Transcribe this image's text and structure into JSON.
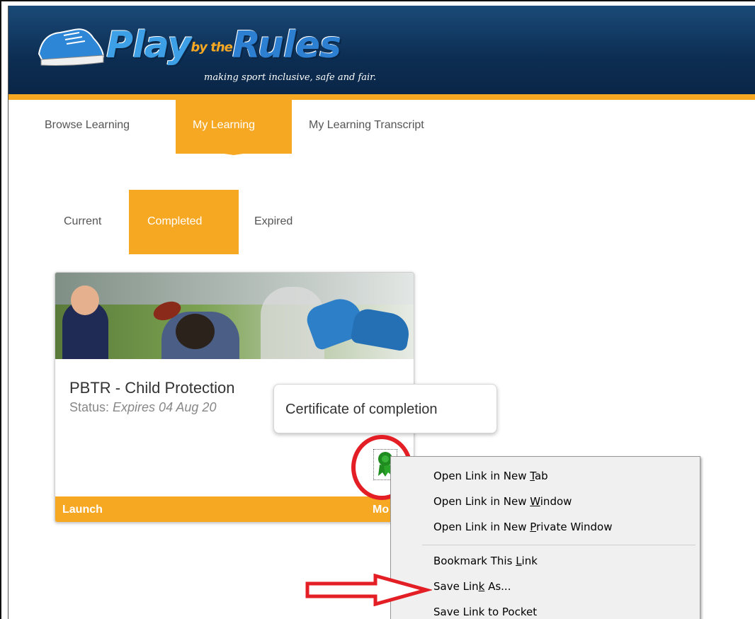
{
  "brand": {
    "wordmark_play": "Play",
    "wordmark_by": "by the",
    "wordmark_rules": "Rules",
    "tagline": "making sport inclusive, safe and fair."
  },
  "nav": {
    "items": [
      {
        "label": "Browse Learning"
      },
      {
        "label": "My Learning",
        "active": true
      },
      {
        "label": "My Learning Transcript"
      }
    ]
  },
  "subtabs": [
    {
      "label": "Current"
    },
    {
      "label": "Completed",
      "active": true
    },
    {
      "label": "Expired"
    }
  ],
  "course_card": {
    "title": "PBTR - Child Protection",
    "status_label": "Status: ",
    "status_value": "Expires 04 Aug 20",
    "launch_label": "Launch",
    "more_label": "Mo"
  },
  "tooltip": {
    "text": "Certificate of completion"
  },
  "context_menu": {
    "items": [
      {
        "pre": "Open Link in New ",
        "key": "T",
        "post": "ab"
      },
      {
        "pre": "Open Link in New ",
        "key": "W",
        "post": "indow"
      },
      {
        "pre": "Open Link in New ",
        "key": "P",
        "post": "rivate Window"
      },
      {
        "pre": "Bookmark This ",
        "key": "L",
        "post": "ink"
      },
      {
        "pre": "Save Lin",
        "key": "k",
        "post": " As..."
      },
      {
        "pre": "Save Link to Pocket",
        "key": "",
        "post": ""
      }
    ]
  },
  "colors": {
    "accent": "#f7a823",
    "header": "#0c2d52",
    "annotation": "#e31e24"
  },
  "icons": {
    "certificate": "certificate-ribbon-icon",
    "annotation_arrow": "right-arrow-icon"
  }
}
